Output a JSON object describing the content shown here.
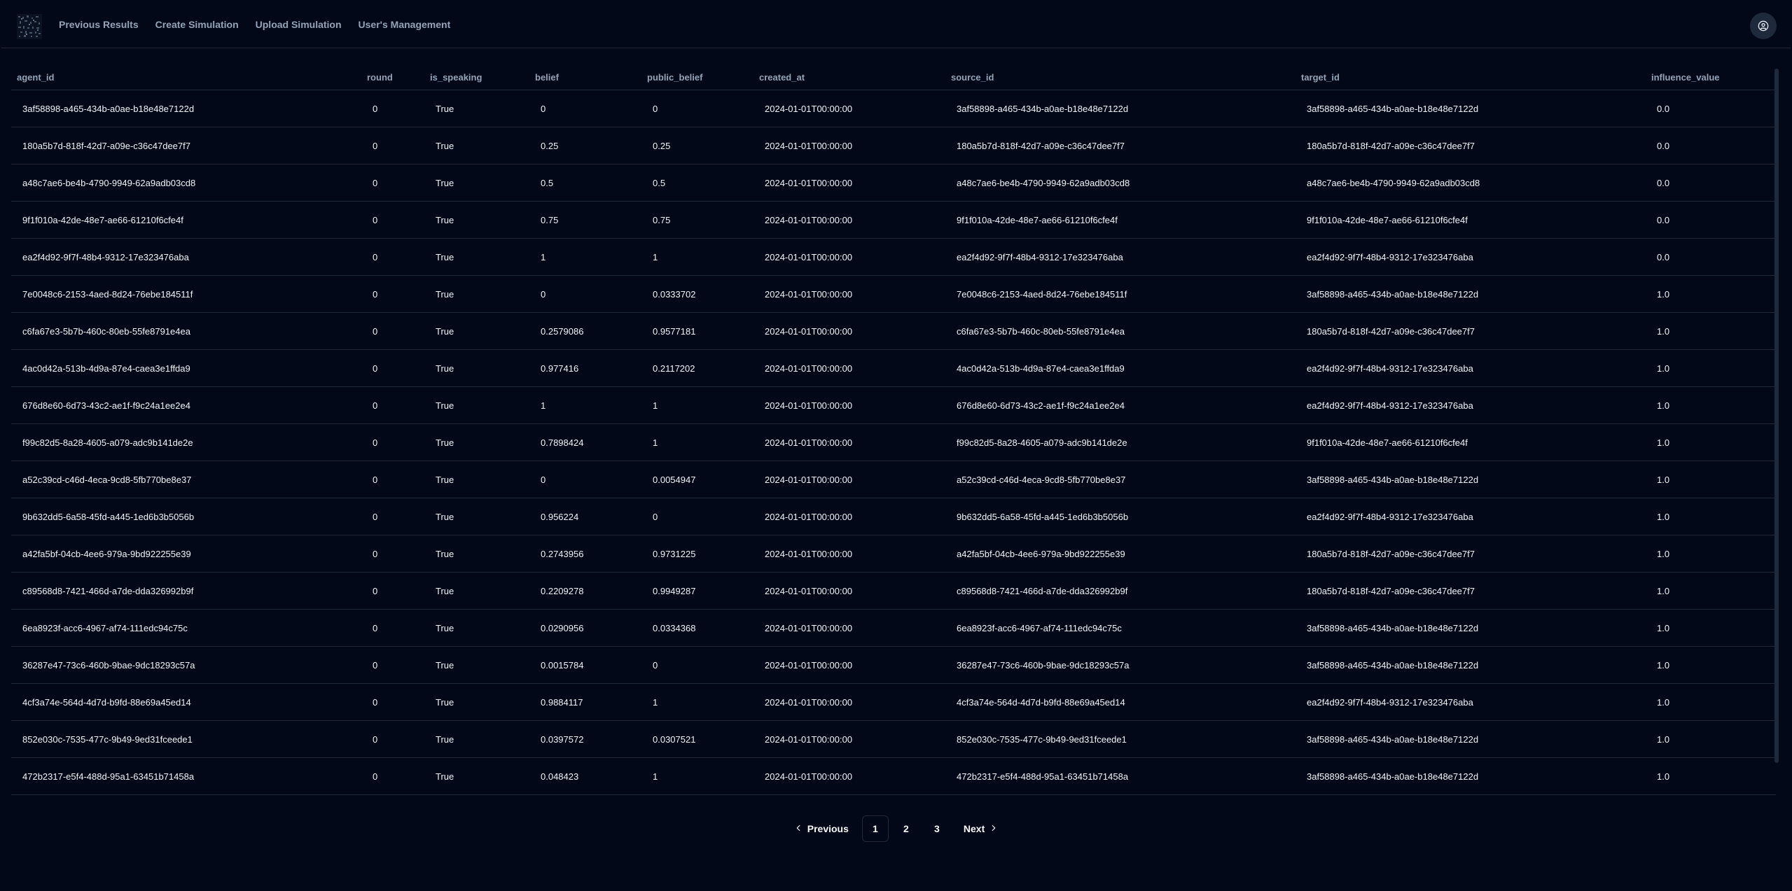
{
  "header": {
    "nav": [
      {
        "label": "Previous Results"
      },
      {
        "label": "Create Simulation"
      },
      {
        "label": "Upload Simulation"
      },
      {
        "label": "User's Management"
      }
    ]
  },
  "table": {
    "columns": [
      "agent_id",
      "round",
      "is_speaking",
      "belief",
      "public_belief",
      "created_at",
      "source_id",
      "target_id",
      "influence_value"
    ],
    "rows": [
      [
        "3af58898-a465-434b-a0ae-b18e48e7122d",
        "0",
        "True",
        "0",
        "0",
        "2024-01-01T00:00:00",
        "3af58898-a465-434b-a0ae-b18e48e7122d",
        "3af58898-a465-434b-a0ae-b18e48e7122d",
        "0.0"
      ],
      [
        "180a5b7d-818f-42d7-a09e-c36c47dee7f7",
        "0",
        "True",
        "0.25",
        "0.25",
        "2024-01-01T00:00:00",
        "180a5b7d-818f-42d7-a09e-c36c47dee7f7",
        "180a5b7d-818f-42d7-a09e-c36c47dee7f7",
        "0.0"
      ],
      [
        "a48c7ae6-be4b-4790-9949-62a9adb03cd8",
        "0",
        "True",
        "0.5",
        "0.5",
        "2024-01-01T00:00:00",
        "a48c7ae6-be4b-4790-9949-62a9adb03cd8",
        "a48c7ae6-be4b-4790-9949-62a9adb03cd8",
        "0.0"
      ],
      [
        "9f1f010a-42de-48e7-ae66-61210f6cfe4f",
        "0",
        "True",
        "0.75",
        "0.75",
        "2024-01-01T00:00:00",
        "9f1f010a-42de-48e7-ae66-61210f6cfe4f",
        "9f1f010a-42de-48e7-ae66-61210f6cfe4f",
        "0.0"
      ],
      [
        "ea2f4d92-9f7f-48b4-9312-17e323476aba",
        "0",
        "True",
        "1",
        "1",
        "2024-01-01T00:00:00",
        "ea2f4d92-9f7f-48b4-9312-17e323476aba",
        "ea2f4d92-9f7f-48b4-9312-17e323476aba",
        "0.0"
      ],
      [
        "7e0048c6-2153-4aed-8d24-76ebe184511f",
        "0",
        "True",
        "0",
        "0.0333702",
        "2024-01-01T00:00:00",
        "7e0048c6-2153-4aed-8d24-76ebe184511f",
        "3af58898-a465-434b-a0ae-b18e48e7122d",
        "1.0"
      ],
      [
        "c6fa67e3-5b7b-460c-80eb-55fe8791e4ea",
        "0",
        "True",
        "0.2579086",
        "0.9577181",
        "2024-01-01T00:00:00",
        "c6fa67e3-5b7b-460c-80eb-55fe8791e4ea",
        "180a5b7d-818f-42d7-a09e-c36c47dee7f7",
        "1.0"
      ],
      [
        "4ac0d42a-513b-4d9a-87e4-caea3e1ffda9",
        "0",
        "True",
        "0.977416",
        "0.2117202",
        "2024-01-01T00:00:00",
        "4ac0d42a-513b-4d9a-87e4-caea3e1ffda9",
        "ea2f4d92-9f7f-48b4-9312-17e323476aba",
        "1.0"
      ],
      [
        "676d8e60-6d73-43c2-ae1f-f9c24a1ee2e4",
        "0",
        "True",
        "1",
        "1",
        "2024-01-01T00:00:00",
        "676d8e60-6d73-43c2-ae1f-f9c24a1ee2e4",
        "ea2f4d92-9f7f-48b4-9312-17e323476aba",
        "1.0"
      ],
      [
        "f99c82d5-8a28-4605-a079-adc9b141de2e",
        "0",
        "True",
        "0.7898424",
        "1",
        "2024-01-01T00:00:00",
        "f99c82d5-8a28-4605-a079-adc9b141de2e",
        "9f1f010a-42de-48e7-ae66-61210f6cfe4f",
        "1.0"
      ],
      [
        "a52c39cd-c46d-4eca-9cd8-5fb770be8e37",
        "0",
        "True",
        "0",
        "0.0054947",
        "2024-01-01T00:00:00",
        "a52c39cd-c46d-4eca-9cd8-5fb770be8e37",
        "3af58898-a465-434b-a0ae-b18e48e7122d",
        "1.0"
      ],
      [
        "9b632dd5-6a58-45fd-a445-1ed6b3b5056b",
        "0",
        "True",
        "0.956224",
        "0",
        "2024-01-01T00:00:00",
        "9b632dd5-6a58-45fd-a445-1ed6b3b5056b",
        "ea2f4d92-9f7f-48b4-9312-17e323476aba",
        "1.0"
      ],
      [
        "a42fa5bf-04cb-4ee6-979a-9bd922255e39",
        "0",
        "True",
        "0.2743956",
        "0.9731225",
        "2024-01-01T00:00:00",
        "a42fa5bf-04cb-4ee6-979a-9bd922255e39",
        "180a5b7d-818f-42d7-a09e-c36c47dee7f7",
        "1.0"
      ],
      [
        "c89568d8-7421-466d-a7de-dda326992b9f",
        "0",
        "True",
        "0.2209278",
        "0.9949287",
        "2024-01-01T00:00:00",
        "c89568d8-7421-466d-a7de-dda326992b9f",
        "180a5b7d-818f-42d7-a09e-c36c47dee7f7",
        "1.0"
      ],
      [
        "6ea8923f-acc6-4967-af74-111edc94c75c",
        "0",
        "True",
        "0.0290956",
        "0.0334368",
        "2024-01-01T00:00:00",
        "6ea8923f-acc6-4967-af74-111edc94c75c",
        "3af58898-a465-434b-a0ae-b18e48e7122d",
        "1.0"
      ],
      [
        "36287e47-73c6-460b-9bae-9dc18293c57a",
        "0",
        "True",
        "0.0015784",
        "0",
        "2024-01-01T00:00:00",
        "36287e47-73c6-460b-9bae-9dc18293c57a",
        "3af58898-a465-434b-a0ae-b18e48e7122d",
        "1.0"
      ],
      [
        "4cf3a74e-564d-4d7d-b9fd-88e69a45ed14",
        "0",
        "True",
        "0.9884117",
        "1",
        "2024-01-01T00:00:00",
        "4cf3a74e-564d-4d7d-b9fd-88e69a45ed14",
        "ea2f4d92-9f7f-48b4-9312-17e323476aba",
        "1.0"
      ],
      [
        "852e030c-7535-477c-9b49-9ed31fceede1",
        "0",
        "True",
        "0.0397572",
        "0.0307521",
        "2024-01-01T00:00:00",
        "852e030c-7535-477c-9b49-9ed31fceede1",
        "3af58898-a465-434b-a0ae-b18e48e7122d",
        "1.0"
      ],
      [
        "472b2317-e5f4-488d-95a1-63451b71458a",
        "0",
        "True",
        "0.048423",
        "1",
        "2024-01-01T00:00:00",
        "472b2317-e5f4-488d-95a1-63451b71458a",
        "3af58898-a465-434b-a0ae-b18e48e7122d",
        "1.0"
      ]
    ]
  },
  "pagination": {
    "previous_label": "Previous",
    "next_label": "Next",
    "pages": [
      "1",
      "2",
      "3"
    ],
    "current_page": "1"
  },
  "icons": {
    "logo": "app-logo",
    "user": "user-circle-icon",
    "prev": "chevron-left-icon",
    "next": "chevron-right-icon"
  }
}
